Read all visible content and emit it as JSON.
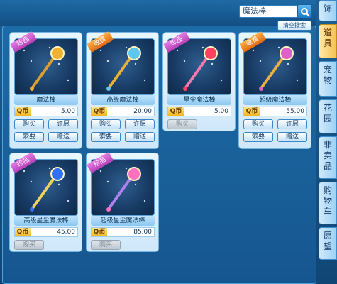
{
  "search": {
    "value": "魔法棒",
    "clear_label": "清空搜索"
  },
  "side_tabs": [
    "饰",
    "道具",
    "宠物",
    "花园",
    "非卖品",
    "购物车",
    "愿望"
  ],
  "currency_label": "Q币",
  "items": [
    {
      "ribbon": "珍品",
      "ribbon_color": "#c84ec9",
      "name": "魔法棒",
      "price": "5.00",
      "buy": "购买",
      "wish": "许愿",
      "ask": "索要",
      "gift": "赠送",
      "full": true,
      "gem": "#f0b030",
      "stick": "#d9a030"
    },
    {
      "ribbon": "收费",
      "ribbon_color": "#f08020",
      "name": "高级魔法棒",
      "price": "20.00",
      "buy": "购买",
      "wish": "许愿",
      "ask": "索要",
      "gift": "赠送",
      "full": true,
      "gem": "#5cc8f0",
      "stick": "#e8b040"
    },
    {
      "ribbon": "珍品",
      "ribbon_color": "#c84ec9",
      "name": "星尘魔法棒",
      "price": "5.00",
      "buy": "购买",
      "full": false,
      "gem": "#ff4060",
      "stick": "#f07ab0"
    },
    {
      "ribbon": "收费",
      "ribbon_color": "#f08020",
      "name": "超级魔法棒",
      "price": "55.00",
      "buy": "购买",
      "wish": "许愿",
      "ask": "索要",
      "gift": "赠送",
      "full": true,
      "gem": "#e060c8",
      "stick": "#e8b040"
    },
    {
      "ribbon": "珍品",
      "ribbon_color": "#c84ec9",
      "name": "高级星尘魔法棒",
      "price": "45.00",
      "buy": "购买",
      "full": false,
      "gem": "#3070ff",
      "stick": "#f0d060"
    },
    {
      "ribbon": "珍品",
      "ribbon_color": "#c84ec9",
      "name": "超级星尘魔法棒",
      "price": "85.00",
      "buy": "购买",
      "full": false,
      "gem": "#ff70c0",
      "stick": "#b080f0"
    }
  ]
}
